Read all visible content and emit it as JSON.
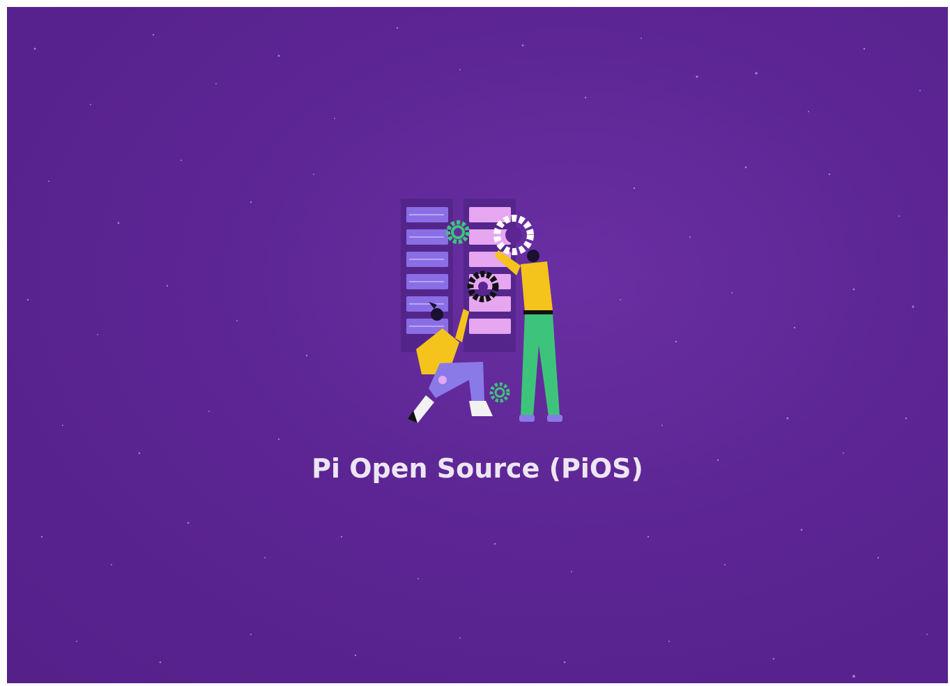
{
  "banner": {
    "title": "Pi Open Source (PiOS)"
  },
  "colors": {
    "background": "#5c2593",
    "title_text": "#ece6f2",
    "server_left": "#8a6ee6",
    "server_right": "#e6a6f0",
    "gear_green": "#3ec47a",
    "gear_black": "#111111",
    "shirt_yellow": "#f4c41c",
    "pants_green": "#3ec47a",
    "pants_lavender": "#8a7ae8"
  },
  "icons": [
    "server-rack-icon",
    "gear-icon",
    "person-icon"
  ]
}
